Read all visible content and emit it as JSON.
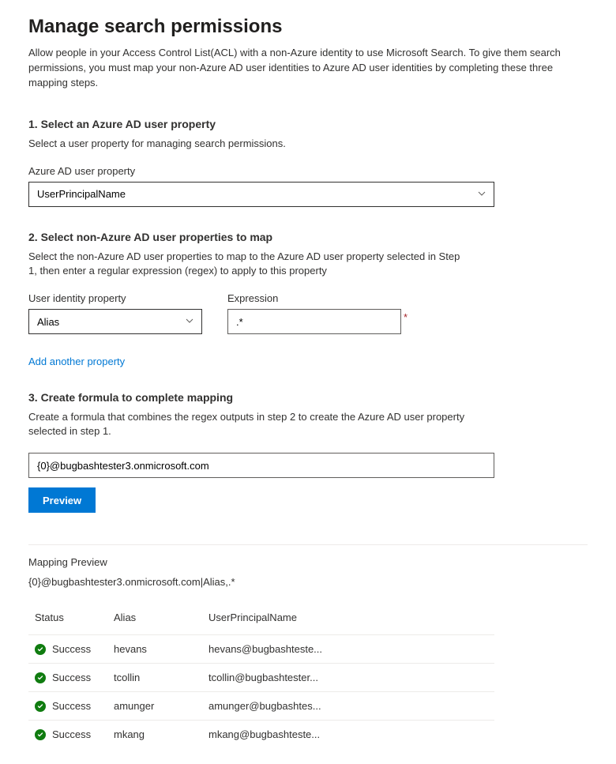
{
  "title": "Manage search permissions",
  "intro": "Allow people in your Access Control List(ACL) with a non-Azure identity to use Microsoft Search. To give them search permissions, you must map your non-Azure AD user identities to Azure AD user identities by completing these three mapping steps.",
  "step1": {
    "heading": "1. Select an Azure AD user property",
    "desc": "Select a user property for managing search permissions.",
    "label": "Azure AD user property",
    "value": "UserPrincipalName"
  },
  "step2": {
    "heading": "2. Select non-Azure AD user properties to map",
    "desc": "Select the non-Azure AD user properties to map to the Azure AD user property selected in Step 1, then enter a regular expression (regex) to apply to this property",
    "identity_label": "User identity property",
    "identity_value": "Alias",
    "expression_label": "Expression",
    "expression_value": ".*",
    "add_link": "Add another property"
  },
  "step3": {
    "heading": "3. Create formula to complete mapping",
    "desc": "Create a formula that combines the regex outputs in step 2 to create the Azure AD user property selected in step 1.",
    "formula_value": "{0}@bugbashtester3.onmicrosoft.com",
    "preview_button": "Preview"
  },
  "preview": {
    "heading": "Mapping Preview",
    "subtext": "{0}@bugbashtester3.onmicrosoft.com|Alias,.*",
    "columns": [
      "Status",
      "Alias",
      "UserPrincipalName"
    ],
    "rows": [
      {
        "status": "Success",
        "alias": "hevans",
        "upn": "hevans@bugbashteste..."
      },
      {
        "status": "Success",
        "alias": "tcollin",
        "upn": "tcollin@bugbashtester..."
      },
      {
        "status": "Success",
        "alias": "amunger",
        "upn": "amunger@bugbashtes..."
      },
      {
        "status": "Success",
        "alias": "mkang",
        "upn": "mkang@bugbashteste..."
      }
    ]
  }
}
